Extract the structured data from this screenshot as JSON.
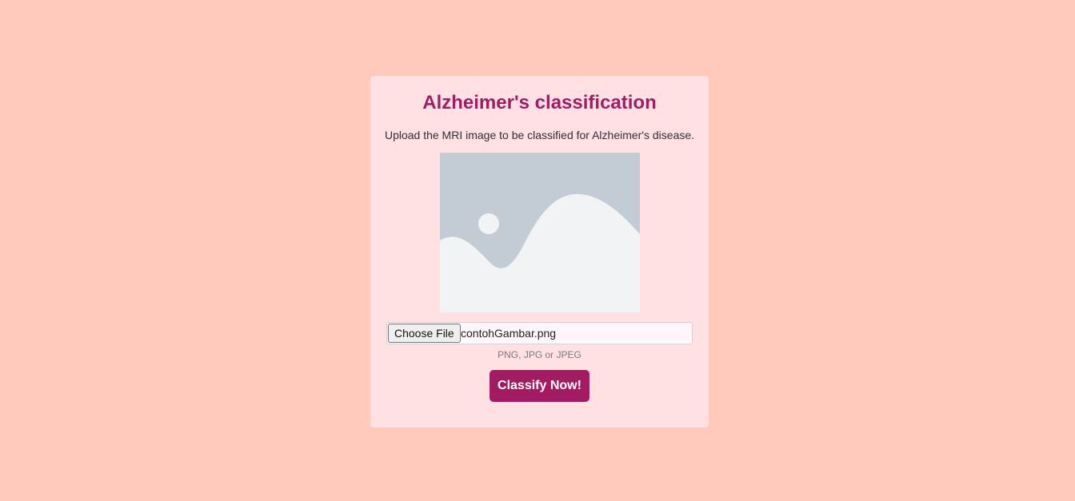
{
  "page": {
    "title": "Alzheimer's classification",
    "subtitle": "Upload the MRI image to be classified for Alzheimer's disease."
  },
  "upload": {
    "choose_label": "Choose File",
    "file_name": "contohGambar.png",
    "hint": "PNG, JPG or JPEG"
  },
  "preview": {
    "icon": "image-placeholder-icon"
  },
  "actions": {
    "classify_label": "Classify Now!"
  },
  "colors": {
    "background": "#ffcabb",
    "card": "#ffe1e3",
    "accent": "#a31c63"
  }
}
